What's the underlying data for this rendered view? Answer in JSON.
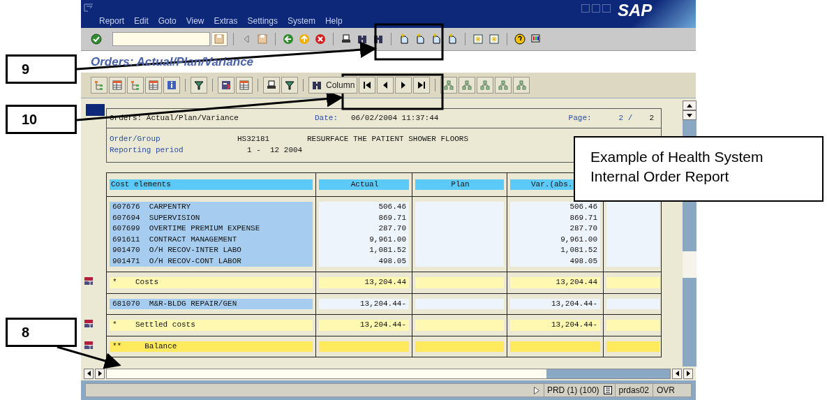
{
  "window": {
    "menu": [
      "Report",
      "Edit",
      "Goto",
      "View",
      "Extras",
      "Settings",
      "System",
      "Help"
    ],
    "logo": "SAP"
  },
  "screen_title": "Orders: Actual/Plan/Variance",
  "app_toolbar": {
    "column_button": "Column"
  },
  "report": {
    "title": "Orders: Actual/Plan/Variance",
    "date_label": "Date:",
    "date": "06/02/2004 11:37:44",
    "page_label": "Page:",
    "page": "2 /",
    "page_total": "2",
    "order_label": "Order/Group",
    "order": "HS32181",
    "order_text": "RESURFACE THE PATIENT SHOWER FLOORS",
    "period_label": "Reporting period",
    "period": "1 -  12 2004",
    "columns": [
      "Cost elements",
      "Actual",
      "Plan",
      "Var.(abs."
    ],
    "sections": [
      {
        "rows": [
          {
            "kind": "item",
            "label": "607676  CARPENTRY",
            "actual": "506.46",
            "variance": "506.46"
          },
          {
            "kind": "item",
            "label": "607694  SUPERVISION",
            "actual": "869.71",
            "variance": "869.71"
          },
          {
            "kind": "item",
            "label": "607699  OVERTIME PREMIUM EXPENSE",
            "actual": "287.70",
            "variance": "287.70"
          },
          {
            "kind": "item",
            "label": "691611  CONTRACT MANAGEMENT",
            "actual": "9,961.00",
            "variance": "9,961.00"
          },
          {
            "kind": "item",
            "label": "901470  O/H RECOV-INTER LABO",
            "actual": "1,081.52",
            "variance": "1,081.52"
          },
          {
            "kind": "item",
            "label": "901471  O/H RECOV-CONT LABOR",
            "actual": "498.05",
            "variance": "498.05"
          }
        ]
      },
      {
        "rows": [
          {
            "kind": "total",
            "label": "*    Costs",
            "actual": "13,204.44",
            "variance": "13,204.44"
          }
        ]
      },
      {
        "rows": [
          {
            "kind": "item",
            "label": "681070  M&R-BLDG REPAIR/GEN",
            "actual": "13,204.44-",
            "variance": "13,204.44-"
          }
        ]
      },
      {
        "rows": [
          {
            "kind": "total",
            "label": "*    Settled costs",
            "actual": "13,204.44-",
            "variance": "13,204.44-"
          }
        ]
      },
      {
        "rows": [
          {
            "kind": "grand_total",
            "label": "**     Balance"
          }
        ]
      }
    ]
  },
  "status_bar": {
    "system": "PRD (1) (100)",
    "server": "prdas02",
    "mode": "OVR"
  },
  "callouts": [
    {
      "label": "9"
    },
    {
      "label": "10"
    },
    {
      "label": "8"
    }
  ],
  "note": "Example of Health System Internal Order Report"
}
